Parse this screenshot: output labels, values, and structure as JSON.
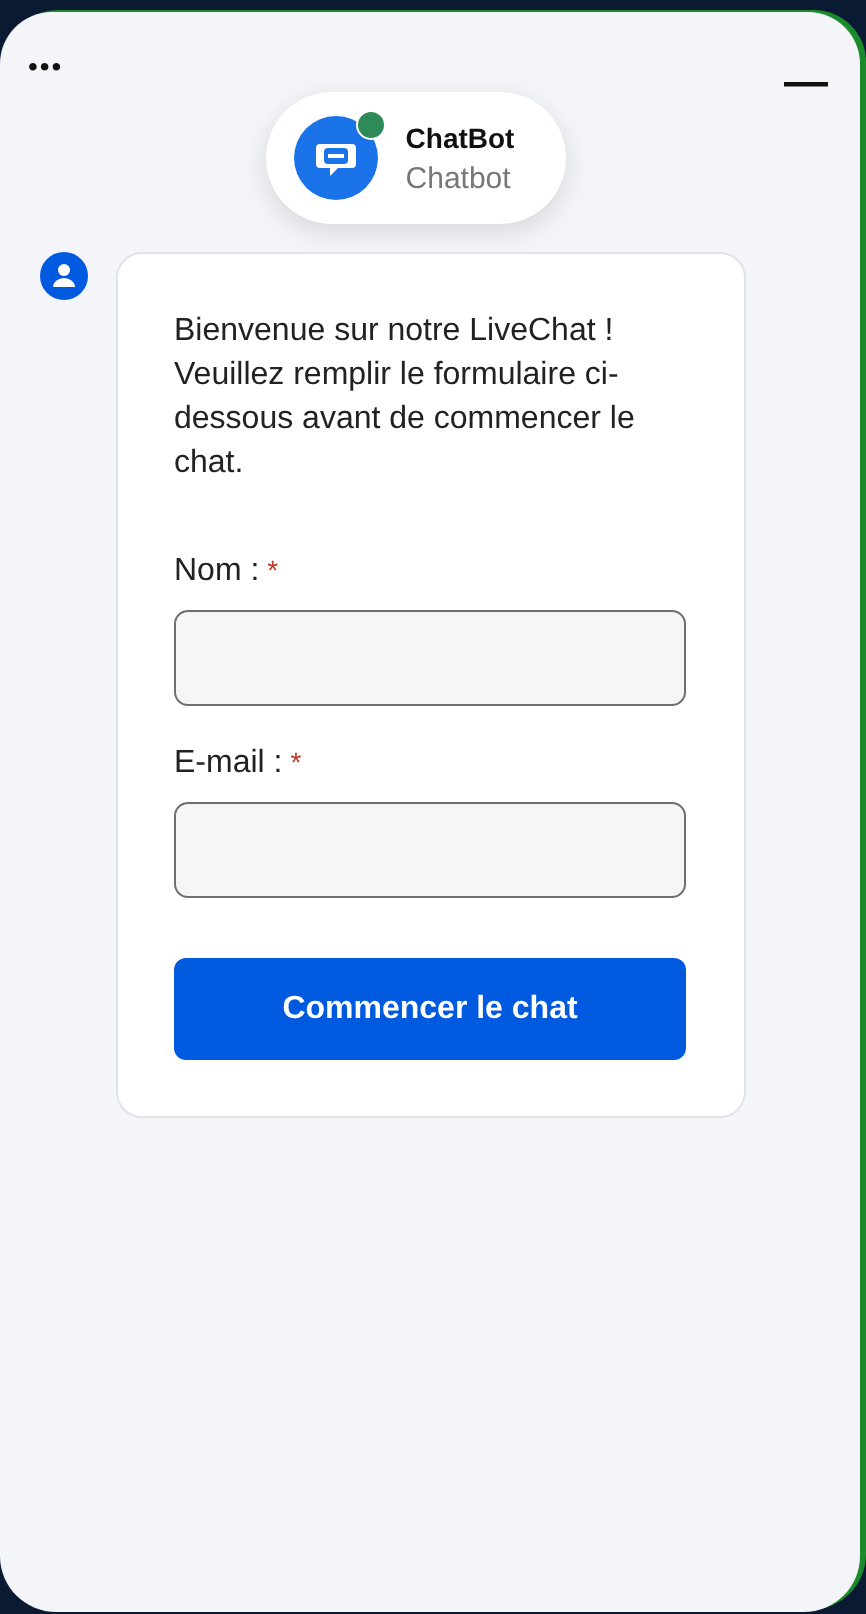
{
  "header": {
    "menu_icon": "•••",
    "minimize_icon": "—"
  },
  "agent": {
    "name": "ChatBot",
    "role": "Chatbot",
    "online": true
  },
  "message": {
    "text": "Bienvenue sur notre LiveChat ! Veuillez remplir le formulaire ci-dessous avant de commencer le chat.",
    "fields": [
      {
        "label": "Nom :",
        "required_mark": "*"
      },
      {
        "label": "E-mail :",
        "required_mark": "*"
      }
    ],
    "button": "Commencer le chat"
  }
}
